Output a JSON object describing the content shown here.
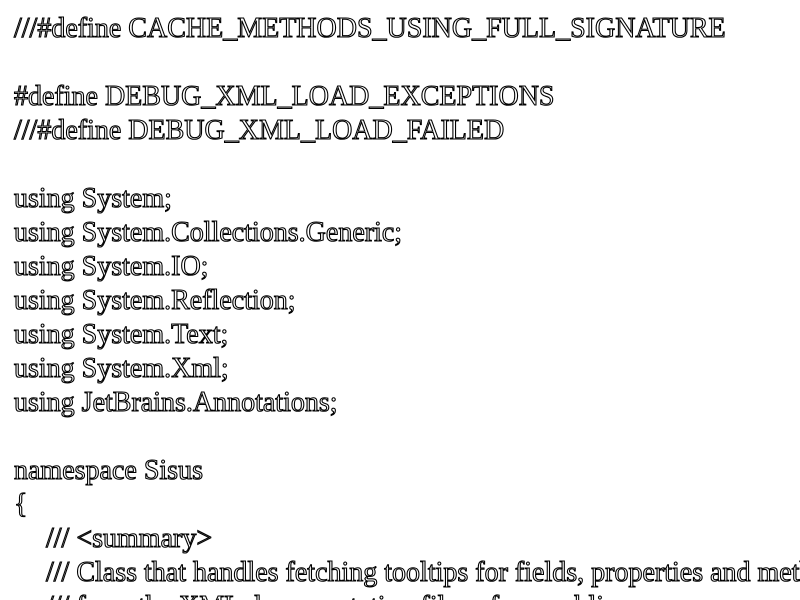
{
  "lines": [
    "///#define CACHE_METHODS_USING_FULL_SIGNATURE",
    "#define DEBUG_XML_LOAD_EXCEPTIONS",
    "///#define DEBUG_XML_LOAD_FAILED",
    "using System;",
    "using System.Collections.Generic;",
    "using System.IO;",
    "using System.Reflection;",
    "using System.Text;",
    "using System.Xml;",
    "using JetBrains.Annotations;",
    "namespace Sisus",
    "{",
    "/// <summary>",
    "/// Class that handles fetching tooltips for fields, properties and methods",
    "/// from the XML documentation files of assemblies."
  ],
  "colors": {
    "background": "#ffffff",
    "text_fill": "#ffffff",
    "text_outline": "#000000"
  }
}
